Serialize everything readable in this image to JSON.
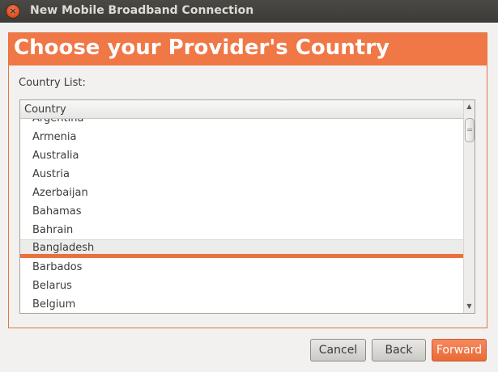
{
  "window": {
    "title": "New Mobile Broadband Connection",
    "close_glyph": "×",
    "close_icon": "close-icon"
  },
  "header": {
    "title": "Choose your Provider's Country"
  },
  "country_list": {
    "label": "Country List:",
    "column_header": "Country",
    "selected": "Bangladesh",
    "items": [
      "Argentina",
      "Armenia",
      "Australia",
      "Austria",
      "Azerbaijan",
      "Bahamas",
      "Bahrain",
      "Bangladesh",
      "Barbados",
      "Belarus",
      "Belgium"
    ]
  },
  "scrollbar": {
    "up_glyph": "▲",
    "down_glyph": "▼",
    "up_icon": "scroll-up-arrow-icon",
    "down_icon": "scroll-down-arrow-icon"
  },
  "buttons": {
    "cancel": "Cancel",
    "back": "Back",
    "forward": "Forward"
  },
  "colors": {
    "accent": "#f07746",
    "selection_underline": "#e9703f",
    "titlebar": "#3c3b37"
  }
}
